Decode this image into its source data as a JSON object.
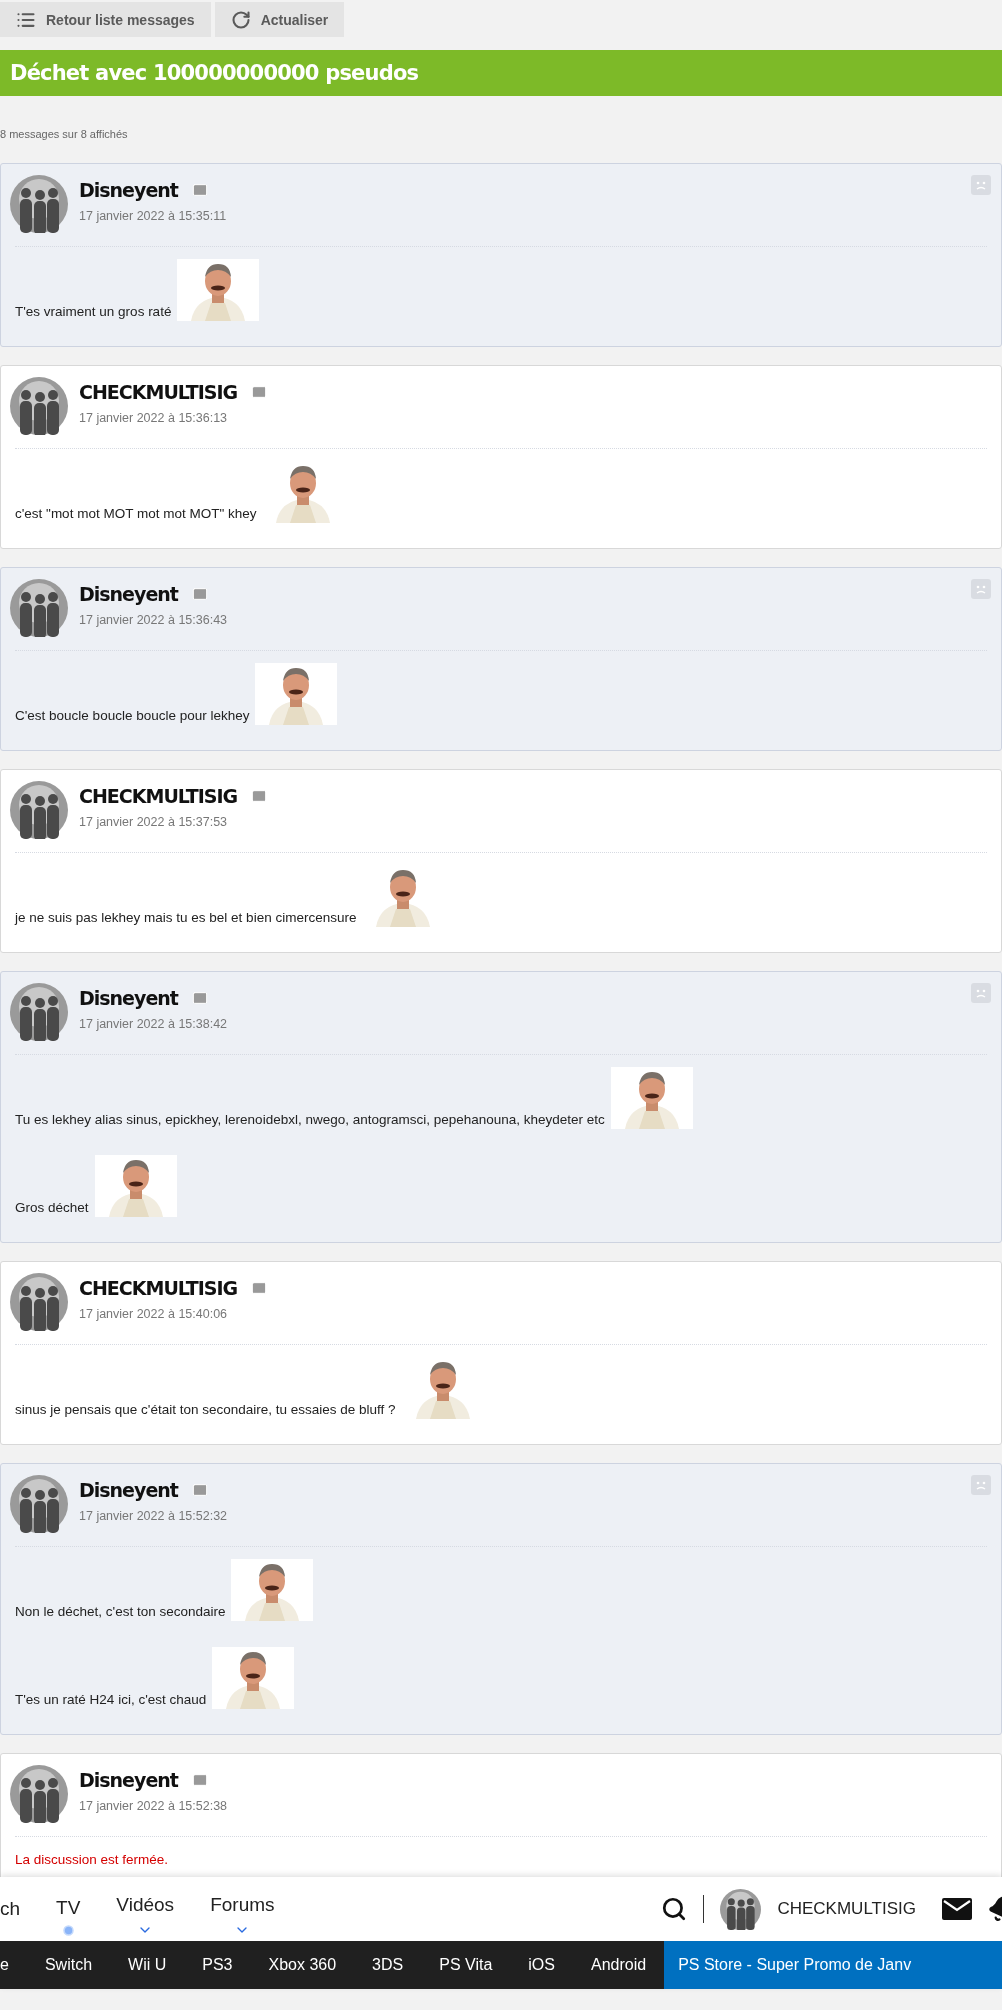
{
  "toolbar": {
    "buttons": [
      {
        "kind": "list",
        "label": "Retour liste messages"
      },
      {
        "kind": "refresh",
        "label": "Actualiser"
      }
    ]
  },
  "topic": {
    "title": "Déchet avec 100000000000 pseudos"
  },
  "count": "8 messages sur 8 affichés",
  "messages": [
    {
      "author": "Disneyent",
      "own": false,
      "date": "17 janvier 2022 à 15:35:11",
      "lines": [
        {
          "kind": "text",
          "text": "T'es vraiment un gros raté",
          "sticker": true
        }
      ]
    },
    {
      "author": "CHECKMULTISIG",
      "own": true,
      "date": "17 janvier 2022 à 15:36:13",
      "lines": [
        {
          "kind": "text",
          "text": "c'est \"mot mot MOT mot mot MOT\" khey",
          "sticker": true
        }
      ]
    },
    {
      "author": "Disneyent",
      "own": false,
      "date": "17 janvier 2022 à 15:36:43",
      "lines": [
        {
          "kind": "text",
          "text": "C'est boucle boucle boucle pour lekhey",
          "sticker": true
        }
      ]
    },
    {
      "author": "CHECKMULTISIG",
      "own": true,
      "date": "17 janvier 2022 à 15:37:53",
      "lines": [
        {
          "kind": "text",
          "text": "je ne suis pas lekhey mais tu es bel et bien cimercensure",
          "sticker": true
        }
      ]
    },
    {
      "author": "Disneyent",
      "own": false,
      "date": "17 janvier 2022 à 15:38:42",
      "lines": [
        {
          "kind": "text",
          "text": "Tu es lekhey alias sinus, epickhey, lerenoidebxl, nwego, antogramsci, pepehanouna, kheydeter etc",
          "sticker": true
        },
        {
          "kind": "text",
          "text": "Gros déchet",
          "sticker": true
        }
      ]
    },
    {
      "author": "CHECKMULTISIG",
      "own": true,
      "date": "17 janvier 2022 à 15:40:06",
      "lines": [
        {
          "kind": "text",
          "text": "sinus je pensais que c'était ton secondaire, tu essaies de bluff ?",
          "sticker": true
        }
      ]
    },
    {
      "author": "Disneyent",
      "own": false,
      "date": "17 janvier 2022 à 15:52:32",
      "lines": [
        {
          "kind": "text",
          "text": "Non le déchet, c'est ton secondaire",
          "sticker": true
        },
        {
          "kind": "text",
          "text": "T'es un raté H24 ici, c'est chaud",
          "sticker": true
        }
      ]
    },
    {
      "author": "Disneyent",
      "own": true,
      "date": "17 janvier 2022 à 15:52:38",
      "lines": [
        {
          "kind": "notice",
          "text": "La discussion est fermée.",
          "sticker": false
        }
      ]
    }
  ],
  "nav": {
    "items": [
      {
        "label": "ch",
        "kind": "plain"
      },
      {
        "label": "TV",
        "kind": "dot"
      },
      {
        "label": "Vidéos",
        "kind": "chevron"
      },
      {
        "label": "Forums",
        "kind": "chevron"
      }
    ],
    "user": "CHECKMULTISIG"
  },
  "platforms": {
    "items": [
      "e",
      "Switch",
      "Wii U",
      "PS3",
      "Xbox 360",
      "3DS",
      "PS Vita",
      "iOS",
      "Android"
    ],
    "promo": "PS Store - Super Promo de Janv"
  }
}
